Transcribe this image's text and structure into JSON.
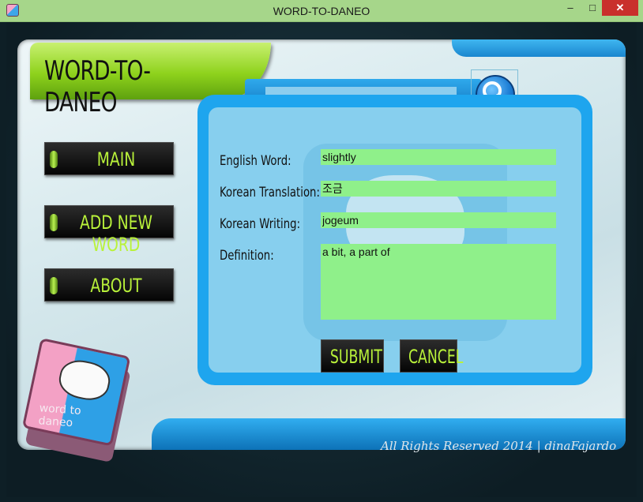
{
  "window": {
    "title": "WORD-TO-DANEO",
    "controls": {
      "minimize": "–",
      "maximize": "□",
      "close": "✕"
    }
  },
  "header": {
    "logo_text": "WORD-TO-DANEO"
  },
  "search": {
    "value": "",
    "placeholder": "",
    "icon": "search-icon"
  },
  "nav": {
    "main": "MAIN",
    "add_new_word": "ADD NEW WORD",
    "about": "ABOUT"
  },
  "form": {
    "english_word_label": "English Word:",
    "english_word_value": "slightly",
    "korean_translation_label": "Korean Translation:",
    "korean_translation_value": "조금",
    "korean_writing_label": "Korean Writing:",
    "korean_writing_value": "jogeum",
    "definition_label": "Definition:",
    "definition_value": "a bit, a part of",
    "submit_label": "SUBMIT",
    "cancel_label": "CANCEL"
  },
  "book_logo": {
    "text": "word to daneo"
  },
  "footer": {
    "text": "All Rights Reserved 2014 | dinaFajardo"
  },
  "colors": {
    "accent_green": "#b9f23a",
    "field_green": "#8ff08a",
    "frame_blue": "#1ea5ee",
    "titlebar": "#a6d68a"
  }
}
